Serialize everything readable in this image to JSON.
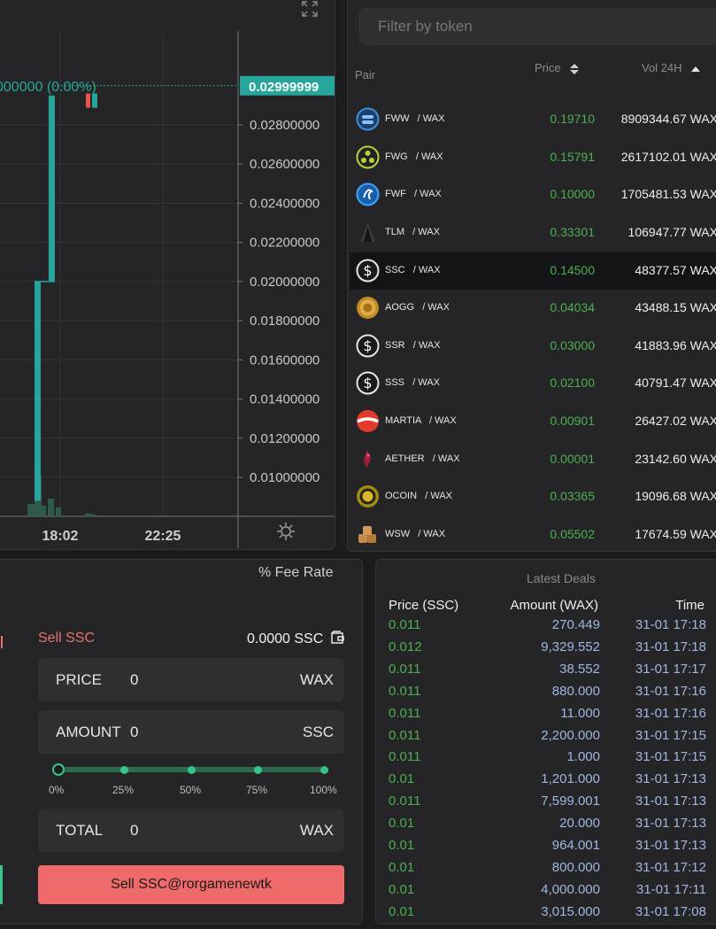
{
  "chart": {
    "ohlc_label": "000000 (0.00%)",
    "current_price": "0.02999999",
    "y_ticks": [
      "0.02800000",
      "0.02600000",
      "0.02400000",
      "0.02200000",
      "0.02000000",
      "0.01800000",
      "0.01600000",
      "0.01400000",
      "0.01200000",
      "0.01000000"
    ],
    "x_ticks": [
      "18:02",
      "22:25"
    ],
    "colors": {
      "up": "#26a69a",
      "down": "#ef5350",
      "label_bg": "#26a69a"
    }
  },
  "pairs": {
    "filter_placeholder": "Filter by token",
    "headers": {
      "pair": "Pair",
      "price": "Price",
      "volume": "Vol 24H"
    },
    "rows": [
      {
        "base": "FWW",
        "quote": "/ WAX",
        "price": "0.19710",
        "volume": "8909344.67 WAX",
        "icon": "fww-icon",
        "selected": false
      },
      {
        "base": "FWG",
        "quote": "/ WAX",
        "price": "0.15791",
        "volume": "2617102.01 WAX",
        "icon": "fwg-icon",
        "selected": false
      },
      {
        "base": "FWF",
        "quote": "/ WAX",
        "price": "0.10000",
        "volume": "1705481.53 WAX",
        "icon": "fwf-icon",
        "selected": false
      },
      {
        "base": "TLM",
        "quote": "/ WAX",
        "price": "0.33301",
        "volume": "106947.77 WAX",
        "icon": "tlm-icon",
        "selected": false
      },
      {
        "base": "SSC",
        "quote": "/ WAX",
        "price": "0.14500",
        "volume": "48377.57 WAX",
        "icon": "dollar-icon",
        "selected": true
      },
      {
        "base": "AOGG",
        "quote": "/ WAX",
        "price": "0.04034",
        "volume": "43488.15 WAX",
        "icon": "aogg-icon",
        "selected": false
      },
      {
        "base": "SSR",
        "quote": "/ WAX",
        "price": "0.03000",
        "volume": "41883.96 WAX",
        "icon": "dollar-icon",
        "selected": false
      },
      {
        "base": "SSS",
        "quote": "/ WAX",
        "price": "0.02100",
        "volume": "40791.47 WAX",
        "icon": "dollar-icon",
        "selected": false
      },
      {
        "base": "MARTIA",
        "quote": "/ WAX",
        "price": "0.00901",
        "volume": "26427.02 WAX",
        "icon": "martia-icon",
        "selected": false
      },
      {
        "base": "AETHER",
        "quote": "/ WAX",
        "price": "0.00001",
        "volume": "23142.60 WAX",
        "icon": "aether-icon",
        "selected": false
      },
      {
        "base": "OCOIN",
        "quote": "/ WAX",
        "price": "0.03365",
        "volume": "19096.68 WAX",
        "icon": "ocoin-icon",
        "selected": false
      },
      {
        "base": "WSW",
        "quote": "/ WAX",
        "price": "0.05502",
        "volume": "17674.59 WAX",
        "icon": "wsw-icon",
        "selected": false
      }
    ]
  },
  "trade": {
    "fee_rate": "% Fee Rate",
    "sell_label": "Sell SSC",
    "balance": "0.0000 SSC",
    "price": {
      "label": "PRICE",
      "value": "0",
      "unit": "WAX"
    },
    "amount": {
      "label": "AMOUNT",
      "value": "0",
      "unit": "SSC"
    },
    "total": {
      "label": "TOTAL",
      "value": "0",
      "unit": "WAX"
    },
    "slider_ticks": [
      "0%",
      "25%",
      "50%",
      "75%",
      "100%"
    ],
    "slider_value": 0,
    "sell_button": "Sell SSC@rorgamenewtk"
  },
  "deals": {
    "title": "Latest Deals",
    "headers": {
      "price": "Price (SSC)",
      "amount": "Amount (WAX)",
      "time": "Time"
    },
    "rows": [
      {
        "price": "0.011",
        "amount": "270.449",
        "time": "31-01 17:18"
      },
      {
        "price": "0.012",
        "amount": "9,329.552",
        "time": "31-01 17:18"
      },
      {
        "price": "0.011",
        "amount": "38.552",
        "time": "31-01 17:17"
      },
      {
        "price": "0.011",
        "amount": "880.000",
        "time": "31-01 17:16"
      },
      {
        "price": "0.011",
        "amount": "11.000",
        "time": "31-01 17:16"
      },
      {
        "price": "0.011",
        "amount": "2,200.000",
        "time": "31-01 17:15"
      },
      {
        "price": "0.011",
        "amount": "1.000",
        "time": "31-01 17:15"
      },
      {
        "price": "0.01",
        "amount": "1,201.000",
        "time": "31-01 17:13"
      },
      {
        "price": "0.011",
        "amount": "7,599.001",
        "time": "31-01 17:13"
      },
      {
        "price": "0.01",
        "amount": "20.000",
        "time": "31-01 17:13"
      },
      {
        "price": "0.01",
        "amount": "964.001",
        "time": "31-01 17:13"
      },
      {
        "price": "0.01",
        "amount": "800.000",
        "time": "31-01 17:12"
      },
      {
        "price": "0.01",
        "amount": "4,000.000",
        "time": "31-01 17:11"
      },
      {
        "price": "0.01",
        "amount": "3,015.000",
        "time": "31-01 17:08"
      }
    ]
  }
}
